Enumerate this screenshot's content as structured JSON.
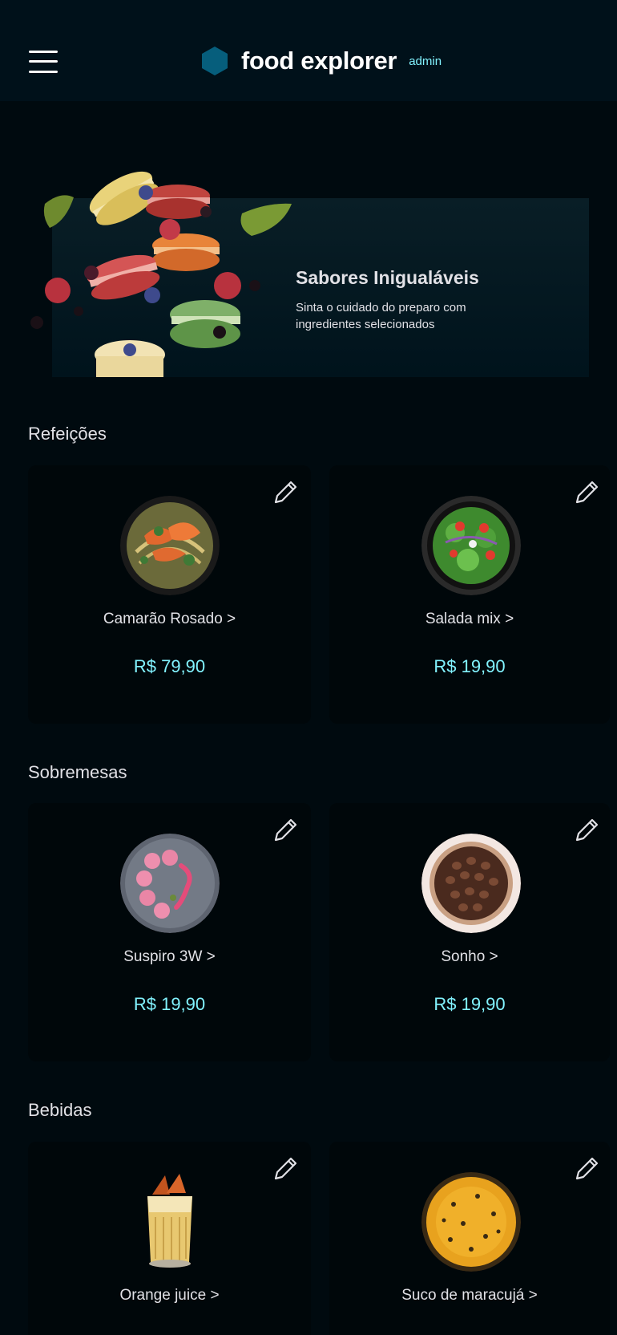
{
  "header": {
    "brand_name": "food explorer",
    "role_label": "admin",
    "menu_icon": "hamburger-menu-icon",
    "logo_icon": "hexagon-logo-icon",
    "accent_color": "#82F3FF",
    "logo_color": "#065E7C"
  },
  "banner": {
    "title": "Sabores Inigualáveis",
    "subtitle": "Sinta o cuidado do preparo com ingredientes selecionados",
    "image_icon": "macarons-illustration"
  },
  "sections": [
    {
      "title": "Refeições",
      "dishes": [
        {
          "name": "Camarão Rosado >",
          "price": "R$ 79,90",
          "image": "shrimp-pasta-photo"
        },
        {
          "name": "Salada mix >",
          "price": "R$ 19,90",
          "image": "salad-photo"
        }
      ]
    },
    {
      "title": "Sobremesas",
      "dishes": [
        {
          "name": "Suspiro 3W >",
          "price": "R$ 19,90",
          "image": "macaron-plate-photo"
        },
        {
          "name": "Sonho >",
          "price": "R$ 19,90",
          "image": "chocolate-pie-photo"
        }
      ]
    },
    {
      "title": "Bebidas",
      "dishes": [
        {
          "name": "Orange juice >",
          "price": "",
          "image": "orange-juice-photo"
        },
        {
          "name": "Suco de maracujá >",
          "price": "",
          "image": "passion-fruit-juice-photo"
        }
      ]
    }
  ],
  "edit_icon": "pencil-edit-icon"
}
